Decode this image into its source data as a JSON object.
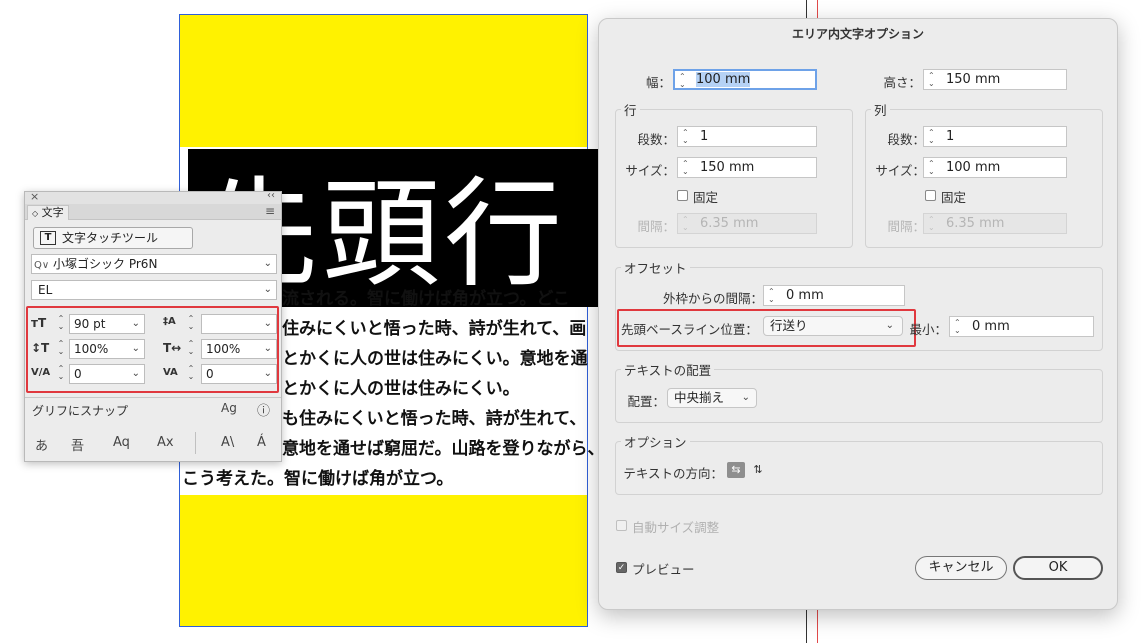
{
  "document": {
    "heading": "先頭行",
    "lines": [
      "流される。智に働けば角が立つ。どこ",
      "住みにくいと悟った時、詩が生れて、画",
      "とかくに人の世は住みにくい。意地を通",
      "とかくに人の世は住みにくい。",
      "も住みにくいと悟った時、詩が生れて、",
      "意地を通せば窮屈だ。山路を登りながら、",
      "こう考えた。智に働けば角が立つ。"
    ]
  },
  "char_panel": {
    "close_glyph": "×",
    "collapse_glyph": "‹‹",
    "tab_label": "文字",
    "tab_prefix": "◇",
    "menu_glyph": "≡",
    "touch_tool_label": "文字タッチツール",
    "font_family": "小塚ゴシック Pr6N",
    "font_search_glyph": "Q∨",
    "font_style": "EL",
    "font_size": "90 pt",
    "leading": "",
    "vertical_scale": "100%",
    "horizontal_scale": "100%",
    "kerning": "0",
    "tracking": "0",
    "snap_label": "グリフにスナップ",
    "icons": {
      "size": "ᴛT",
      "leading": "‡A",
      "vscale": "↕T",
      "hscale": "T↔",
      "kern": "V/A",
      "track": "VA",
      "snap": "Ag",
      "info": "ⓘ",
      "g1": "あ",
      "g2": "吾",
      "g3": "Aq",
      "g4": "Ax",
      "g5": "A\\",
      "g6": "Á"
    }
  },
  "dialog": {
    "title": "エリア内文字オプション",
    "width_label": "幅：",
    "width_value": "100 mm",
    "height_label": "高さ：",
    "height_value": "150 mm",
    "rows_group": "行",
    "cols_group": "列",
    "rows_count_label": "段数：",
    "rows_count": "1",
    "cols_count_label": "段数：",
    "cols_count": "1",
    "rows_size_label": "サイズ：",
    "rows_size": "150 mm",
    "cols_size_label": "サイズ：",
    "cols_size": "100 mm",
    "fixed_label": "固定",
    "gutter_label": "間隔：",
    "rows_gutter": "6.35 mm",
    "cols_gutter": "6.35 mm",
    "offset_group": "オフセット",
    "inset_label": "外枠からの間隔：",
    "inset_value": "0 mm",
    "baseline_label": "先頭ベースライン位置：",
    "baseline_value": "行送り",
    "min_label": "最小：",
    "min_value": "0 mm",
    "align_group": "テキストの配置",
    "align_label": "配置：",
    "align_value": "中央揃え",
    "options_group": "オプション",
    "direction_label": "テキストの方向：",
    "autosize_label": "自動サイズ調整",
    "preview_label": "プレビュー",
    "cancel_label": "キャンセル",
    "ok_label": "OK",
    "spin_glyph": "⌃⌄",
    "chevron": "⌄",
    "check_glyph": "✓"
  }
}
